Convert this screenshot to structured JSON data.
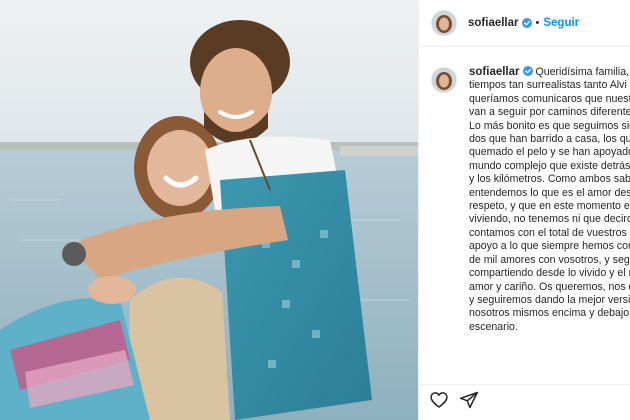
{
  "post": {
    "username": "sofiaellar",
    "follow_label": "Seguir",
    "separator": "•",
    "caption": "Queridísima familia, en estos tiempos tan surrealistas tanto Alvi como yo queríamos comunicaros que nuestras vidas van a seguir por caminos diferentes.\nLo más bonito es que seguimos siendo esos dos que han barrido a casa, los que se han quemado el pelo y se han apoyado en un mundo complejo que existe detrás del telón y los kilómetros. Como ambos sabemos que entendemos lo que es el amor desde el respeto, y que en este momento estamos viviendo, no tenemos ni que deciros que contamos con el total de vuestros abrazos y apoyo a lo que siempre hemos compartido de mil amores con vosotros, y seguiremos compartiendo desde lo vivido y el más puro amor y cariño. Os queremos, nos queremos y seguiremos dando la mejor versión de nosotros mismos encima y debajo del escenario."
  },
  "icons": {
    "verified": "verified-badge-icon",
    "like": "heart-outline-icon",
    "share": "paper-plane-icon"
  },
  "colors": {
    "link_blue": "#0095f6",
    "text": "#262626",
    "border": "#efefef",
    "sea": "#a9c3cf",
    "sky": "#e7ecef"
  }
}
